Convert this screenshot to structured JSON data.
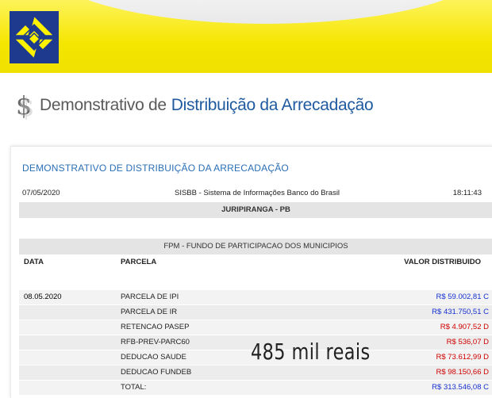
{
  "header": {
    "title_prefix": "Demonstrativo de",
    "title_main": "Distribuição da Arrecadação"
  },
  "panel": {
    "title": "DEMONSTRATIVO DE DISTRIBUIÇÃO DA ARRECADAÇÃO",
    "date": "07/05/2020",
    "system": "SISBB - Sistema de Informações Banco do Brasil",
    "time": "18:11:43",
    "municipality": "JURIPIRANGA - PB",
    "fund": "FPM - FUNDO DE PARTICIPACAO DOS MUNICIPIOS",
    "columns": {
      "date": "DATA",
      "parcel": "PARCELA",
      "value": "VALOR DISTRIBUIDO"
    },
    "rows": [
      {
        "date": "08.05.2020",
        "parcel": "PARCELA DE IPI",
        "value": "R$ 59.002,81 C"
      },
      {
        "date": "",
        "parcel": "PARCELA DE IR",
        "value": "R$ 431.750,51 C"
      },
      {
        "date": "",
        "parcel": "RETENCAO PASEP",
        "value": "R$ 4.907,52 D"
      },
      {
        "date": "",
        "parcel": "RFB-PREV-PARC60",
        "value": "R$ 536,07 D"
      },
      {
        "date": "",
        "parcel": "DEDUCAO SAUDE",
        "value": "R$ 73.612,99 D"
      },
      {
        "date": "",
        "parcel": "DEDUCAO FUNDEB",
        "value": "R$ 98.150,66 D"
      },
      {
        "date": "",
        "parcel": "TOTAL:",
        "value": "R$ 313.546,08 C"
      }
    ]
  },
  "overlay_caption": "485 mil reais",
  "colors": {
    "brand_yellow": "#f5e600",
    "brand_blue": "#1f5aa0",
    "credit": "#1530d0",
    "debit": "#d00000"
  }
}
